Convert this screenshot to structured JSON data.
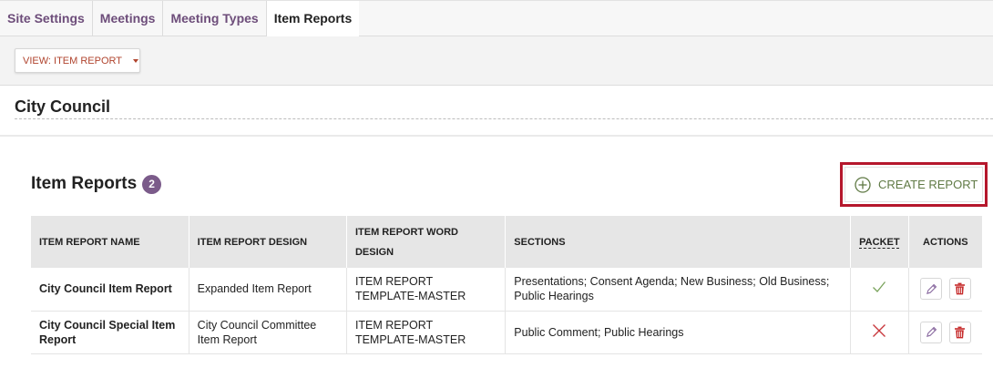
{
  "tabs": [
    {
      "label": "Site Settings",
      "active": false
    },
    {
      "label": "Meetings",
      "active": false
    },
    {
      "label": "Meeting Types",
      "active": false
    },
    {
      "label": "Item Reports",
      "active": true
    }
  ],
  "view_dropdown": {
    "label": "VIEW: ITEM REPORT"
  },
  "section": {
    "title": "City Council"
  },
  "item_reports": {
    "title": "Item Reports",
    "count": "2",
    "create_label": "CREATE REPORT"
  },
  "table": {
    "headers": {
      "name": "ITEM REPORT NAME",
      "design": "ITEM REPORT DESIGN",
      "word_design": "ITEM REPORT WORD DESIGN",
      "sections": "SECTIONS",
      "packet": "PACKET",
      "actions": "ACTIONS"
    },
    "rows": [
      {
        "name": "City Council Item Report",
        "design": "Expanded Item Report",
        "word_design": "ITEM REPORT TEMPLATE-MASTER",
        "sections": "Presentations; Consent Agenda; New Business; Old Business; Public Hearings",
        "packet": true
      },
      {
        "name": "City Council Special Item Report",
        "design": "City Council Committee Item Report",
        "word_design": "ITEM REPORT TEMPLATE-MASTER",
        "sections": "Public Comment; Public Hearings",
        "packet": false
      }
    ]
  },
  "colors": {
    "tab_text": "#6d4d7a",
    "badge": "#7b5b8a",
    "dropdown_text": "#b0442e",
    "create_text": "#607a45",
    "highlight": "#b5172c",
    "check": "#7aa35c",
    "cross": "#c8373c",
    "edit_icon": "#8a6aa0",
    "delete_icon": "#c62b2b"
  }
}
